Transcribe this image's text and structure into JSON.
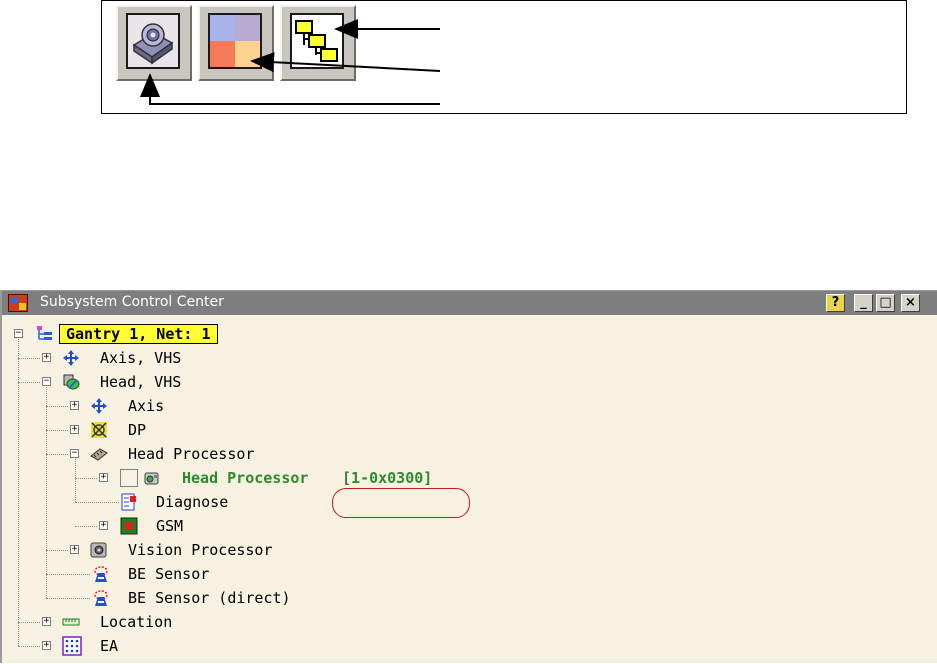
{
  "window": {
    "title": "Subsystem Control Center",
    "buttons": {
      "help": "?",
      "minimize": "_",
      "maximize": "□",
      "close": "×"
    }
  },
  "tree": {
    "root": "Gantry 1, Net: 1",
    "axis_vhs": "Axis, VHS",
    "head_vhs": "Head, VHS",
    "axis": "Axis",
    "dp": "DP",
    "head_processor_group": "Head Processor",
    "head_processor_item": "Head Processor",
    "head_processor_address": "[1-0x0300]",
    "diagnose": "Diagnose",
    "gsm": "GSM",
    "vision_processor": "Vision Processor",
    "be_sensor": "BE Sensor",
    "be_sensor_direct": "BE Sensor (direct)",
    "location": "Location",
    "ea": "EA",
    "expander_plus": "+",
    "expander_minus": "−"
  },
  "colors": {
    "root_highlight": "#ffff33",
    "active_text": "#2e8b2e",
    "annotation_red": "#d01818",
    "window_bg": "#f6f1e1"
  },
  "icons": {
    "toolbar": [
      "vision-camera-icon",
      "color-palette-icon",
      "tree-hierarchy-icon"
    ],
    "tree": [
      "tree-root-icon",
      "move-arrows-icon",
      "head-icon",
      "axis-arrows-icon",
      "dp-icon",
      "chip-icon",
      "camera-device-icon",
      "diagnose-icon",
      "gsm-icon",
      "vision-processor-icon",
      "sensor-icon",
      "location-icon",
      "ea-grid-icon"
    ]
  }
}
